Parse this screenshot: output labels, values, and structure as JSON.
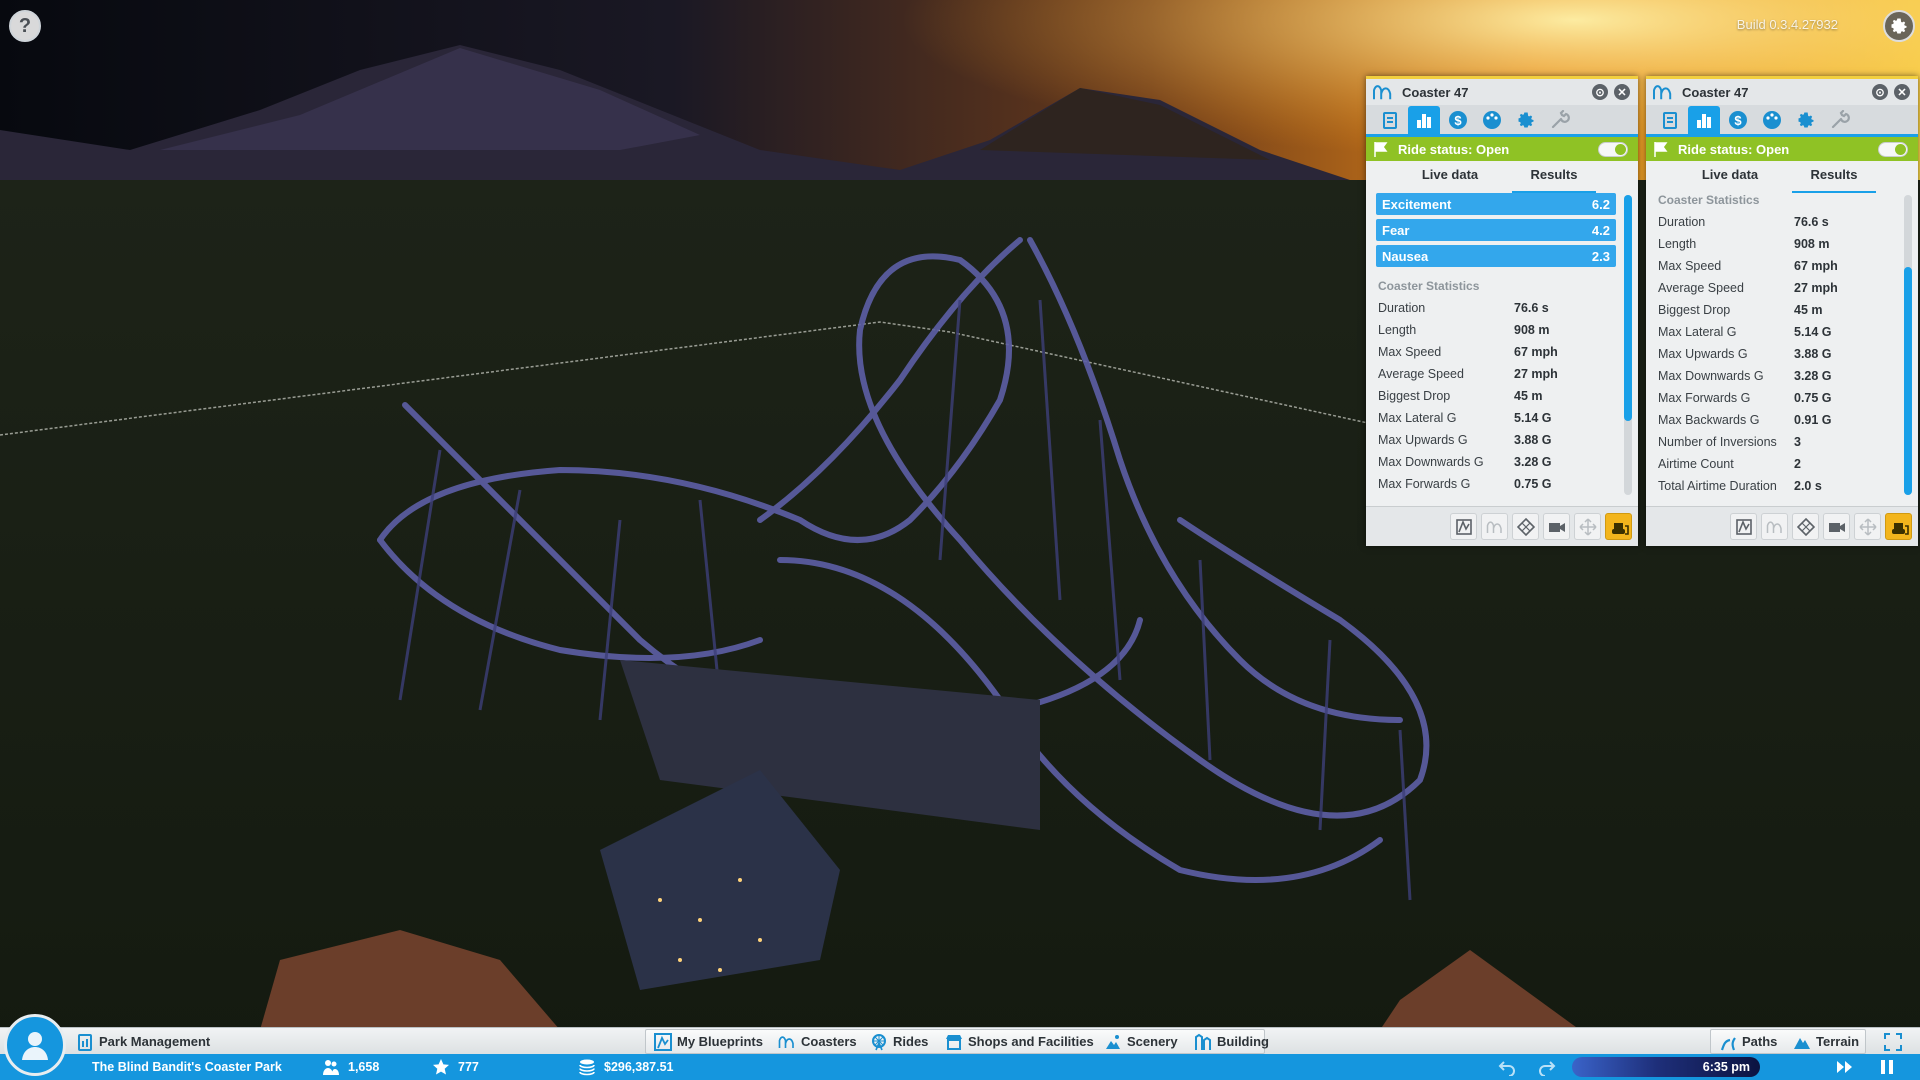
{
  "app": {
    "build": "Build 0.3.4.27932",
    "help_glyph": "?"
  },
  "panels": [
    {
      "title": "Coaster 47",
      "status": "Ride status: Open",
      "tabs": [
        "info-icon",
        "stats-icon",
        "finance-icon",
        "colors-icon",
        "settings-icon",
        "maintenance-icon"
      ],
      "subtabs": {
        "live": "Live data",
        "results": "Results"
      },
      "ratings": [
        {
          "label": "Excitement",
          "value": "6.2"
        },
        {
          "label": "Fear",
          "value": "4.2"
        },
        {
          "label": "Nausea",
          "value": "2.3"
        }
      ],
      "section_title": "Coaster Statistics",
      "stats": [
        {
          "label": "Duration",
          "value": "76.6 s"
        },
        {
          "label": "Length",
          "value": "908 m"
        },
        {
          "label": "Max Speed",
          "value": "67 mph"
        },
        {
          "label": "Average Speed",
          "value": "27 mph"
        },
        {
          "label": "Biggest Drop",
          "value": "45 m"
        },
        {
          "label": "Max Lateral G",
          "value": "5.14 G"
        },
        {
          "label": "Max Upwards G",
          "value": "3.88 G"
        },
        {
          "label": "Max Downwards  G",
          "value": "3.28 G"
        },
        {
          "label": "Max Forwards G",
          "value": "0.75 G"
        }
      ]
    },
    {
      "title": "Coaster 47",
      "status": "Ride status: Open",
      "tabs": [
        "info-icon",
        "stats-icon",
        "finance-icon",
        "colors-icon",
        "settings-icon",
        "maintenance-icon"
      ],
      "subtabs": {
        "live": "Live data",
        "results": "Results"
      },
      "section_title": "Coaster Statistics",
      "stats": [
        {
          "label": "Duration",
          "value": "76.6 s"
        },
        {
          "label": "Length",
          "value": "908 m"
        },
        {
          "label": "Max Speed",
          "value": "67 mph"
        },
        {
          "label": "Average Speed",
          "value": "27 mph"
        },
        {
          "label": "Biggest Drop",
          "value": "45 m"
        },
        {
          "label": "Max Lateral G",
          "value": "5.14 G"
        },
        {
          "label": "Max Upwards G",
          "value": "3.88 G"
        },
        {
          "label": "Max Downwards  G",
          "value": "3.28 G"
        },
        {
          "label": "Max Forwards G",
          "value": "0.75 G"
        },
        {
          "label": "Max Backwards G",
          "value": "0.91 G"
        },
        {
          "label": "Number of Inversions",
          "value": "3"
        },
        {
          "label": "Airtime Count",
          "value": "2"
        },
        {
          "label": "Total Airtime Duration",
          "value": "2.0 s"
        }
      ]
    }
  ],
  "toolbar": {
    "park_management": "Park Management",
    "my_blueprints": "My Blueprints",
    "coasters": "Coasters",
    "rides": "Rides",
    "shops": "Shops and Facilities",
    "scenery": "Scenery",
    "building": "Building",
    "paths": "Paths",
    "terrain": "Terrain"
  },
  "info_bar": {
    "park_name": "The Blind Bandit's Coaster Park",
    "guests": "1,658",
    "rating": "777",
    "money": "$296,387.51",
    "time": "6:35 pm"
  },
  "colors": {
    "accent": "#19a0e8",
    "status_open": "#8fc225",
    "highlight_gold": "#f3b51c"
  }
}
